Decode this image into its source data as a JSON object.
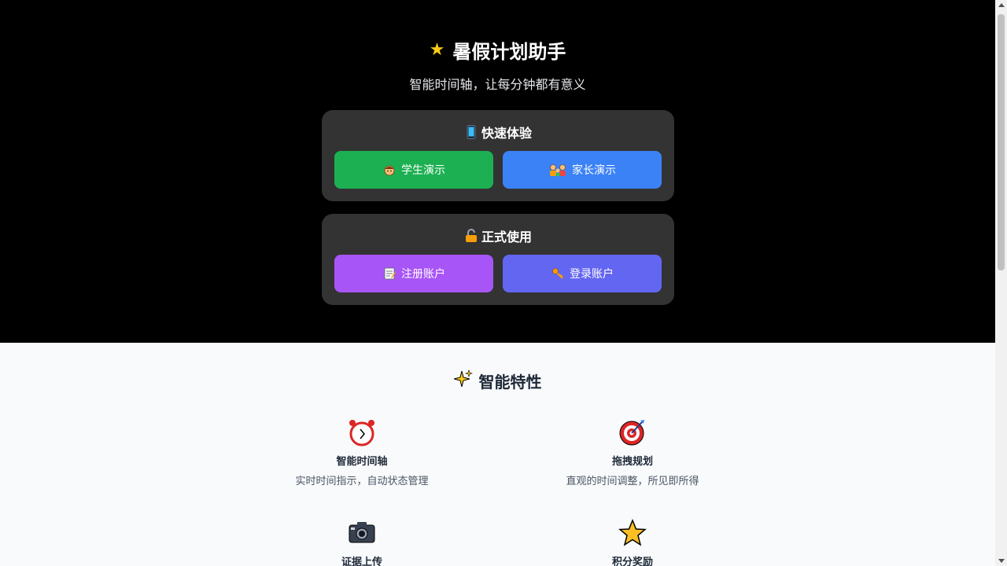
{
  "hero": {
    "title": "暑假计划助手",
    "subtitle": "智能时间轴，让每分钟都有意义",
    "title_icon": "star-icon"
  },
  "quick_demo": {
    "title": "快速体验",
    "icon": "mobile-phone-icon",
    "student_button": "学生演示",
    "parent_button": "家长演示"
  },
  "formal_use": {
    "title": "正式使用",
    "icon": "lock-icon",
    "register_button": "注册账户",
    "login_button": "登录账户"
  },
  "features": {
    "title": "智能特性",
    "title_icon": "sparkles-icon",
    "items": [
      {
        "title": "智能时间轴",
        "desc": "实时时间指示，自动状态管理",
        "icon": "alarm-clock-icon"
      },
      {
        "title": "拖拽规划",
        "desc": "直观的时间调整，所见即所得",
        "icon": "target-icon"
      },
      {
        "title": "证据上传",
        "desc": "",
        "icon": "camera-icon"
      },
      {
        "title": "积分奖励",
        "desc": "",
        "icon": "star-icon"
      }
    ]
  },
  "colors": {
    "green": "#1db053",
    "blue": "#3b82f6",
    "purple": "#a855f7",
    "indigo": "#6366f1",
    "card": "#333333",
    "hero_bg": "#000000"
  }
}
